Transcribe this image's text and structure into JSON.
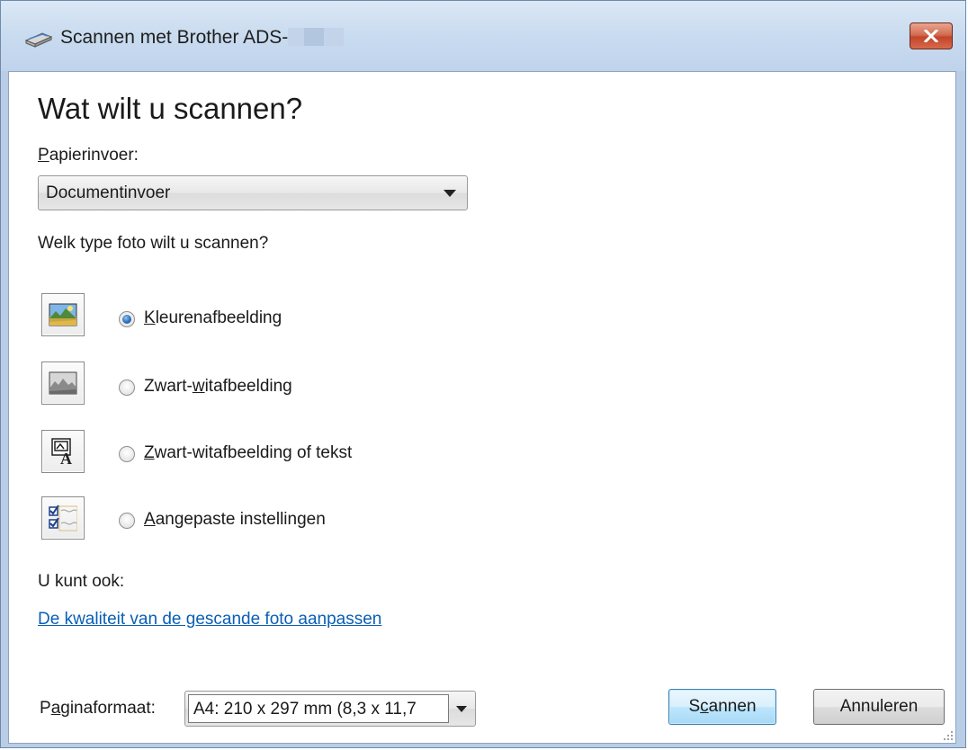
{
  "window": {
    "title": "Scannen met Brother ADS-",
    "title_icon": "scanner-icon",
    "close_icon": "close-icon"
  },
  "dialog": {
    "heading": "Wat wilt u scannen?",
    "paper_source_label_mnemonic": "P",
    "paper_source_label_rest": "apierinvoer:",
    "paper_source_value": "Documentinvoer",
    "photo_type_question": "Welk type foto wilt u scannen?",
    "options": [
      {
        "mnemonic": "K",
        "rest": "leurenafbeelding",
        "checked": true,
        "icon": "color-picture-icon"
      },
      {
        "prefix": "Zwart-",
        "mnemonic": "w",
        "rest": "itafbeelding",
        "checked": false,
        "icon": "grayscale-picture-icon"
      },
      {
        "mnemonic": "Z",
        "rest": "wart-witafbeelding of tekst",
        "checked": false,
        "icon": "text-picture-icon"
      },
      {
        "mnemonic": "A",
        "rest": "angepaste instellingen",
        "checked": false,
        "icon": "custom-settings-icon"
      }
    ],
    "also_label": "U kunt ook:",
    "quality_link": "De kwaliteit van de gescande foto aanpassen",
    "page_size_label_prefix": "P",
    "page_size_label_mnemonic": "a",
    "page_size_label_rest": "ginaformaat:",
    "page_size_value": "A4: 210 x 297 mm (8,3 x 11,7",
    "scan_button_prefix": "S",
    "scan_button_mnemonic": "c",
    "scan_button_rest": "annen",
    "cancel_button": "Annuleren"
  },
  "colors": {
    "link": "#0a5fb4",
    "radio_checked": "#2c6fb8",
    "close_button": "#c2452a"
  }
}
